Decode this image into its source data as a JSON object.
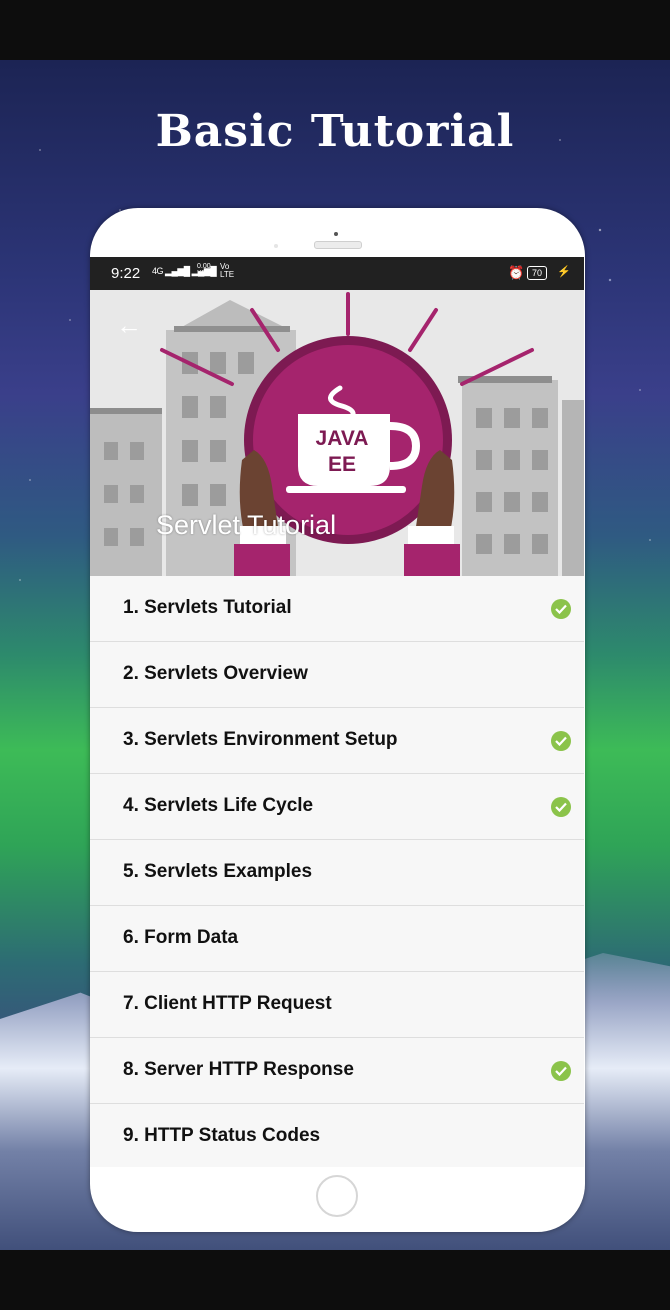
{
  "headline": "Basic Tutorial",
  "status_bar": {
    "time": "9:22",
    "network": "4G",
    "speed_value": "0.00",
    "speed_unit": "KB/S",
    "volte_top": "Vo",
    "volte_bottom": "LTE",
    "battery": "70"
  },
  "hero": {
    "title": "Servlet Tutorial",
    "logo_line1": "JAVA",
    "logo_line2": "EE"
  },
  "colors": {
    "accent": "#a5246d",
    "check": "#8bc34a",
    "status_bar": "#212121"
  },
  "lessons": [
    {
      "label": "1. Servlets Tutorial",
      "completed": true
    },
    {
      "label": "2. Servlets Overview",
      "completed": false
    },
    {
      "label": "3. Servlets Environment Setup",
      "completed": true
    },
    {
      "label": "4. Servlets Life Cycle",
      "completed": true
    },
    {
      "label": "5. Servlets Examples",
      "completed": false
    },
    {
      "label": "6. Form Data",
      "completed": false
    },
    {
      "label": "7. Client HTTP Request",
      "completed": false
    },
    {
      "label": "8. Server HTTP Response",
      "completed": true
    },
    {
      "label": "9. HTTP Status Codes",
      "completed": false
    }
  ]
}
